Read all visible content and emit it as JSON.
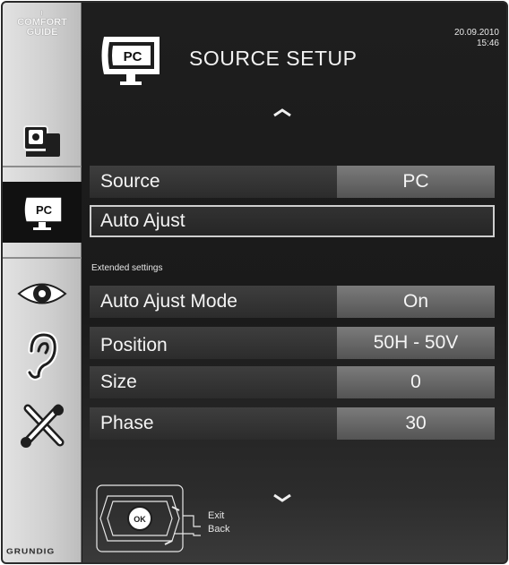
{
  "sidebar": {
    "comfort_line1": "COMFORT",
    "comfort_line2": "GUIDE",
    "brand": "GRUNDIG",
    "items": [
      {
        "icon": "media-interaction-icon"
      },
      {
        "icon": "pc-source-icon",
        "label": "PC",
        "active": true
      },
      {
        "icon": "eye-icon"
      },
      {
        "icon": "ear-icon"
      },
      {
        "icon": "tools-icon"
      }
    ]
  },
  "header": {
    "icon_label": "PC",
    "title": "SOURCE SETUP",
    "date": "20.09.2010",
    "time": "15:46"
  },
  "menu": {
    "source": {
      "label": "Source",
      "value": "PC"
    },
    "auto_adjust": {
      "label": "Auto Ajust"
    },
    "extended_label": "Extended settings",
    "auto_adjust_mode": {
      "label": "Auto Ajust Mode",
      "value": "On"
    },
    "position": {
      "label": "Position",
      "value": "50H - 50V"
    },
    "size": {
      "label": "Size",
      "value": "0"
    },
    "phase": {
      "label": "Phase",
      "value": "30"
    }
  },
  "footer": {
    "ok_label": "OK",
    "exit_label": "Exit",
    "back_label": "Back"
  },
  "colors": {
    "background": "#1b1b1b",
    "sidebar": "#cfcfcf",
    "value_box": "#6a6a6a",
    "text": "#f4f4f4"
  }
}
